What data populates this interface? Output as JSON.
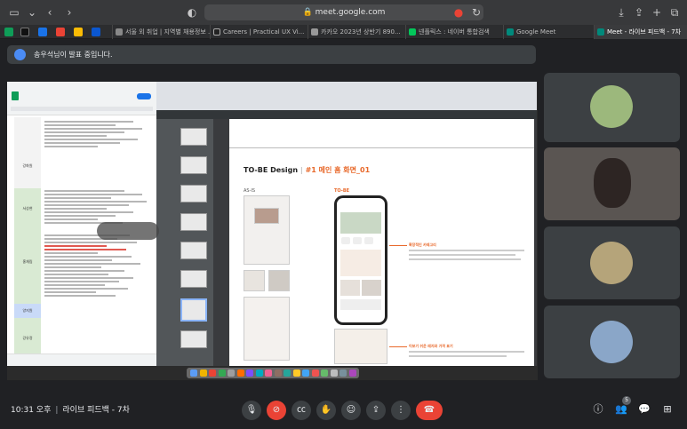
{
  "browser": {
    "url": "meet.google.com",
    "tabs": [
      {
        "label": "서울 외 취업 | 지역별 채용정보 ..."
      },
      {
        "label": "Careers | Practical UX Vi..."
      },
      {
        "label": "카카오 2023년 상반기 890..."
      },
      {
        "label": "넨플릭스 : 네이버 통합검색"
      },
      {
        "label": "Google Meet"
      },
      {
        "label": "Meet - 라이브 피드백 - 7차"
      }
    ]
  },
  "banner": {
    "text": "송우석님이 발표 중입니다."
  },
  "shared": {
    "pdf_heading": "TO-BE Design",
    "pdf_heading_sub": "#1 메인 홈 화면_01",
    "as_is": "AS-IS",
    "to_be": "TO-BE",
    "sheet_sections": [
      "강화원",
      "서상현",
      "홍채림",
      "양지원",
      "강유정"
    ],
    "notes": [
      {
        "text": "확장적인 카테고리"
      },
      {
        "text": "이보기 쉬운 레지와 가격 표기"
      }
    ]
  },
  "meeting": {
    "time": "10:31 오후",
    "name": "라이브 피드백 - 7차",
    "participants_count": "5"
  },
  "colors": {
    "accent_blue": "#4b8cf5",
    "end_red": "#ea4335",
    "pdf_accent": "#e8692b"
  }
}
